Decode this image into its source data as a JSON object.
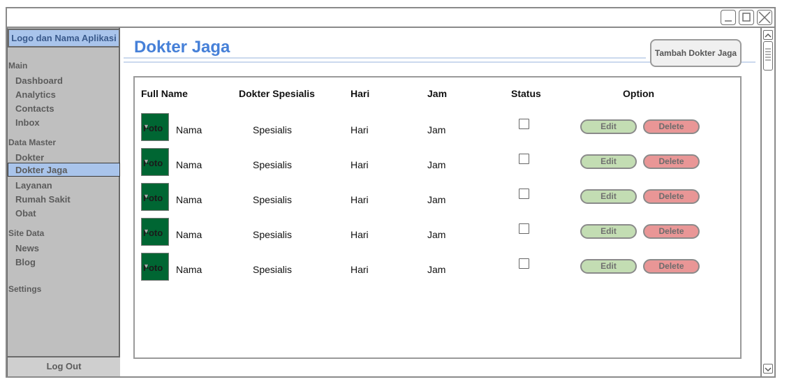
{
  "window": {
    "controls": [
      "minimize-icon",
      "maximize-icon",
      "close-icon"
    ]
  },
  "sidebar": {
    "logo": "Logo dan Nama Aplikasi",
    "sections": [
      {
        "label": "Main",
        "items": [
          "Dashboard",
          "Analytics",
          "Contacts",
          "Inbox"
        ]
      },
      {
        "label": "Data Master",
        "items": [
          "Dokter",
          "Dokter Jaga",
          "Layanan",
          "Rumah Sakit",
          "Obat"
        ]
      },
      {
        "label": "Site Data",
        "items": [
          "News",
          "Blog"
        ]
      },
      {
        "label": "Settings",
        "items": []
      }
    ],
    "active_item": "Dokter Jaga",
    "logout": "Log Out"
  },
  "header": {
    "title": "Dokter Jaga",
    "add_button": "Tambah Dokter Jaga"
  },
  "table": {
    "columns": [
      "Full Name",
      "Dokter Spesialis",
      "Hari",
      "Jam",
      "Status",
      "Option"
    ],
    "rows": [
      {
        "photo": "Foto",
        "name": "Nama",
        "specialist": "Spesialis",
        "day": "Hari",
        "time": "Jam",
        "status_checked": false
      },
      {
        "photo": "Foto",
        "name": "Nama",
        "specialist": "Spesialis",
        "day": "Hari",
        "time": "Jam",
        "status_checked": false
      },
      {
        "photo": "Foto",
        "name": "Nama",
        "specialist": "Spesialis",
        "day": "Hari",
        "time": "Jam",
        "status_checked": false
      },
      {
        "photo": "Foto",
        "name": "Nama",
        "specialist": "Spesialis",
        "day": "Hari",
        "time": "Jam",
        "status_checked": false
      },
      {
        "photo": "Foto",
        "name": "Nama",
        "specialist": "Spesialis",
        "day": "Hari",
        "time": "Jam",
        "status_checked": false
      }
    ],
    "edit_label": "Edit",
    "delete_label": "Delete"
  },
  "colors": {
    "accent": "#4680d8",
    "sidebar_bg": "#bfbfbf",
    "active_bg": "#a9c4eb",
    "photo_bg": "#006633",
    "edit_bg": "#c3ddb3",
    "delete_bg": "#e99696"
  }
}
